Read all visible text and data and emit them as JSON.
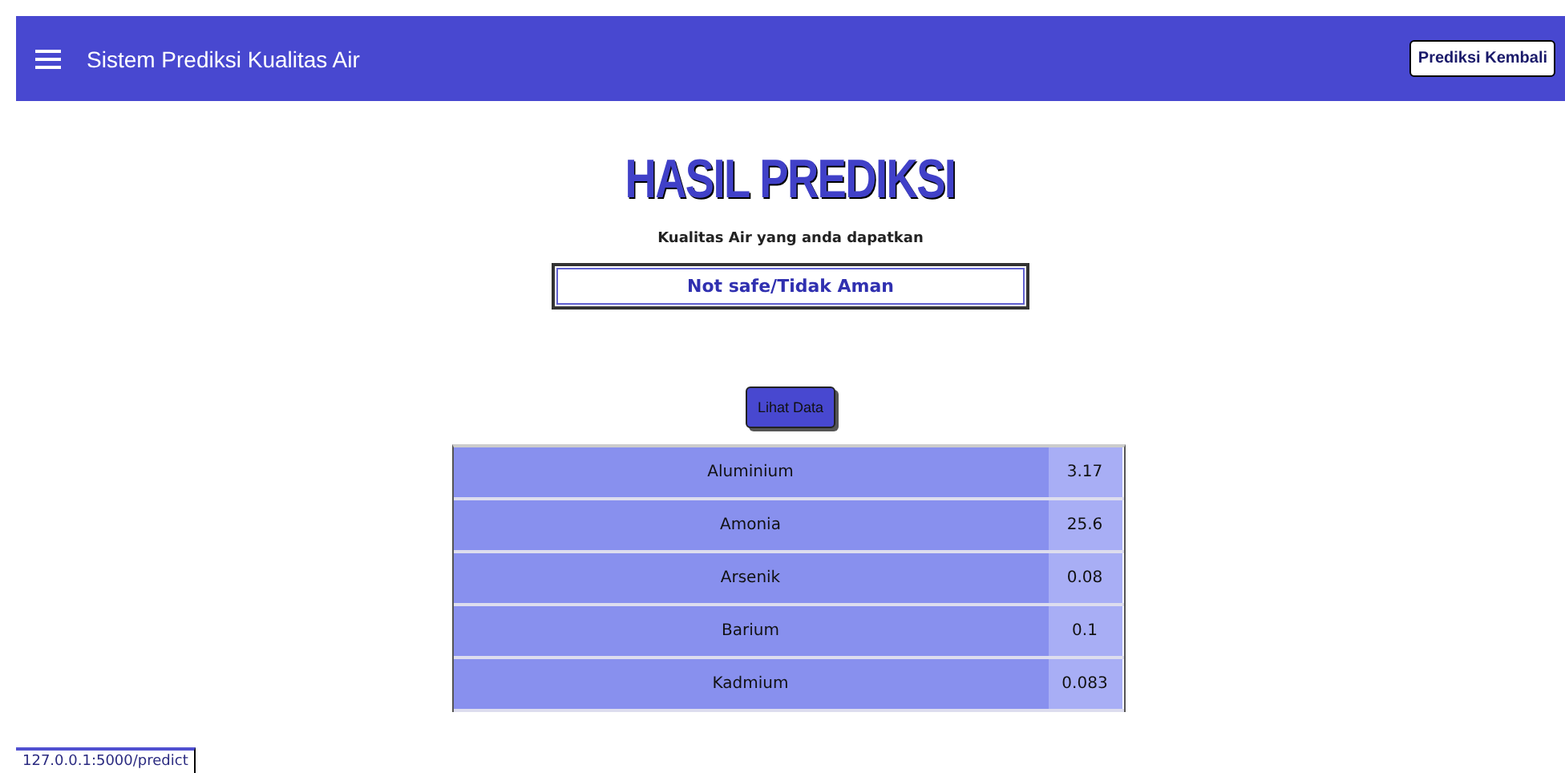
{
  "navbar": {
    "title": "Sistem Prediksi Kualitas Air",
    "button": "Prediksi Kembali"
  },
  "heading": "HASIL PREDIKSI",
  "result": {
    "label": "Kualitas Air yang anda dapatkan",
    "value": "Not safe/Tidak Aman"
  },
  "detail_button": "Lihat Data",
  "table": {
    "rows": [
      {
        "name": "Aluminium",
        "value": "3.17"
      },
      {
        "name": "Amonia",
        "value": "25.6"
      },
      {
        "name": "Arsenik",
        "value": "0.08"
      },
      {
        "name": "Barium",
        "value": "0.1"
      },
      {
        "name": "Kadmium",
        "value": "0.083"
      }
    ]
  },
  "status_bar": {
    "url": "127.0.0.1:5000/predict"
  }
}
